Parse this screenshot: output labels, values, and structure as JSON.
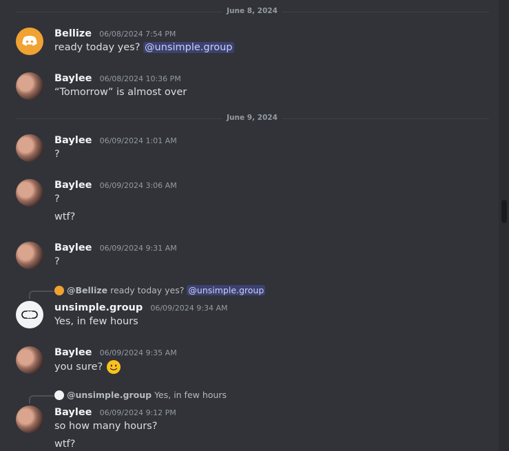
{
  "dividers": [
    "June 8, 2024",
    "June 9, 2024"
  ],
  "messages": [
    {
      "author": "Bellize",
      "time": "06/08/2024 7:54 PM",
      "text": "ready today yes?",
      "mention": "@unsimple.group"
    },
    {
      "author": "Baylee",
      "time": "06/08/2024 10:36 PM",
      "text": "“Tomorrow” is almost over"
    },
    {
      "author": "Baylee",
      "time": "06/09/2024 1:01 AM",
      "text": "?"
    },
    {
      "author": "Baylee",
      "time": "06/09/2024 3:06 AM",
      "text": "?",
      "text2": "wtf?"
    },
    {
      "author": "Baylee",
      "time": "06/09/2024 9:31 AM",
      "text": "?"
    },
    {
      "author": "unsimple.group",
      "time": "06/09/2024 9:34 AM",
      "text": "Yes, in few hours",
      "reply": {
        "name": "@Bellize",
        "text": "ready today yes?",
        "mention": "@unsimple.group"
      }
    },
    {
      "author": "Baylee",
      "time": "06/09/2024 9:35 AM",
      "text": "you sure?",
      "emoji": "slightly-smiling-face-icon"
    },
    {
      "author": "Baylee",
      "time": "06/09/2024 9:12 PM",
      "text": "so how many hours?",
      "text2": "wtf?",
      "reply": {
        "name": "@unsimple.group",
        "text": "Yes, in few hours"
      }
    }
  ],
  "colors": {
    "background": "#313338",
    "mention_bg": "#3c4270",
    "mention_fg": "#c9cdfb",
    "bellize_avatar": "#f0a232"
  }
}
